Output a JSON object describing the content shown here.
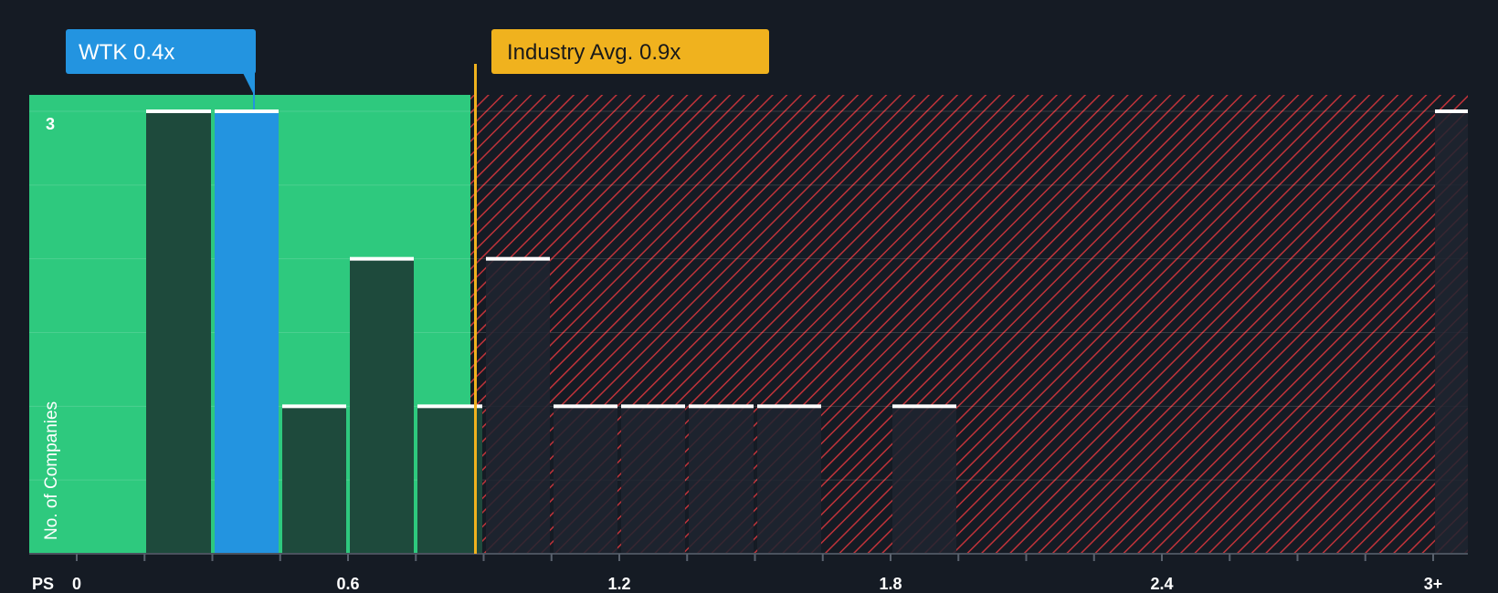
{
  "chart_data": {
    "type": "bar",
    "title": "",
    "xlabel": "PS",
    "ylabel": "No. of Companies",
    "x_ticks": [
      "0",
      "0.6",
      "1.2",
      "1.8",
      "2.4",
      "3+"
    ],
    "y_ticks": [
      "3"
    ],
    "xlim": [
      0,
      3.0
    ],
    "ylim": [
      0,
      3
    ],
    "bin_width": 0.15,
    "bins": [
      {
        "x_start": 0.15,
        "x_end": 0.3,
        "value": 3
      },
      {
        "x_start": 0.3,
        "x_end": 0.45,
        "value": 3,
        "highlight": true
      },
      {
        "x_start": 0.45,
        "x_end": 0.6,
        "value": 1
      },
      {
        "x_start": 0.6,
        "x_end": 0.75,
        "value": 2
      },
      {
        "x_start": 0.75,
        "x_end": 0.9,
        "value": 1
      },
      {
        "x_start": 0.9,
        "x_end": 1.05,
        "value": 2
      },
      {
        "x_start": 1.05,
        "x_end": 1.2,
        "value": 1
      },
      {
        "x_start": 1.2,
        "x_end": 1.35,
        "value": 1
      },
      {
        "x_start": 1.35,
        "x_end": 1.5,
        "value": 1
      },
      {
        "x_start": 1.5,
        "x_end": 1.65,
        "value": 1
      },
      {
        "x_start": 1.8,
        "x_end": 1.95,
        "value": 1
      },
      {
        "x_start": 3.0,
        "x_end": 3.08,
        "value": 3
      }
    ],
    "company": {
      "label": "WTK 0.4x",
      "value": 0.4
    },
    "industry_avg": {
      "label": "Industry Avg. 0.9x",
      "value": 0.9
    },
    "fair_range_end": 0.87,
    "grid": true
  },
  "colors": {
    "background": "#151b24",
    "fair_zone": "#2ec97e",
    "bar_dark": "#1e4a3c",
    "bar_highlight": "#2394e0",
    "bar_red_zone": "#1f2530",
    "hatch": "#c0333a",
    "avg_line": "#f0b21e",
    "bar_cap": "#ffffff"
  }
}
